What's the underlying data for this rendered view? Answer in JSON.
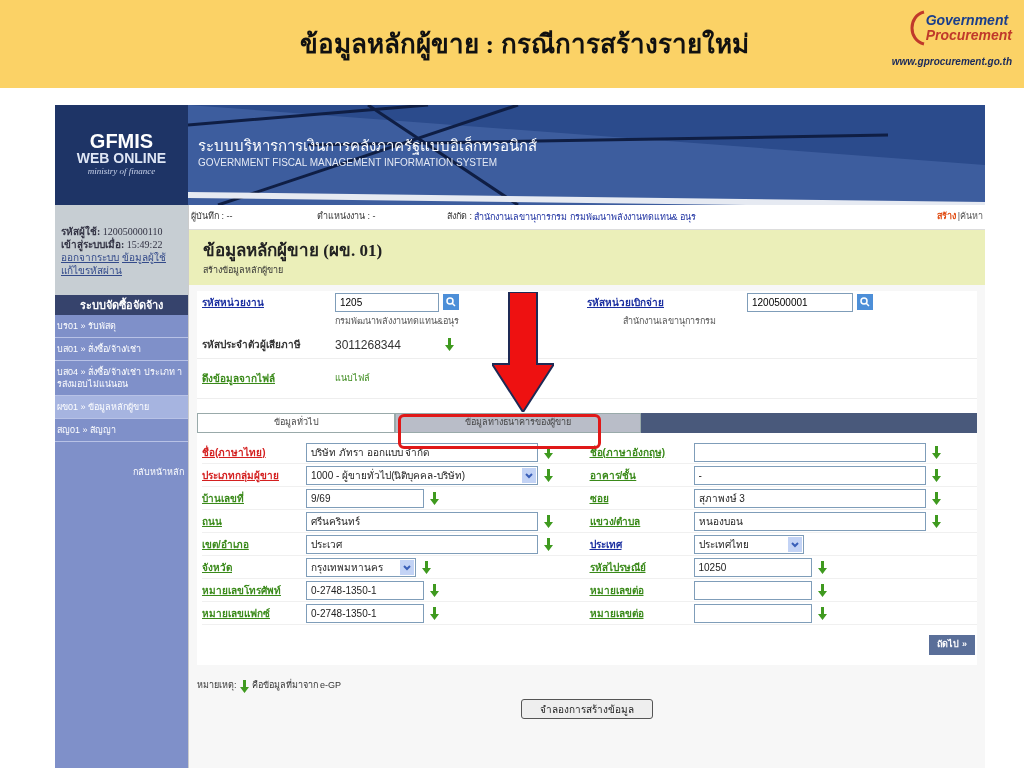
{
  "slide": {
    "title": "ข้อมูลหลักผู้ขาย : กรณีการสร้างรายใหม่",
    "logo_lines": [
      "Government",
      "Procurement"
    ],
    "url": "www.gprocurement.go.th"
  },
  "app": {
    "logo": {
      "title": "GFMIS",
      "subtitle": "WEB ONLINE",
      "tagline": "ministry of finance"
    },
    "system_name_th": "ระบบบริหารการเงินการคลังภาครัฐแบบอิเล็กทรอนิกส์",
    "system_name_en": "GOVERNMENT FISCAL MANAGEMENT INFORMATION SYSTEM",
    "user": {
      "id_label": "รหัสผู้ใช้:",
      "id": "120050000110",
      "login_label": "เข้าสู่ระบบเมื่อ:",
      "login_time": "15:49:22",
      "links": [
        "ออกจากระบบ",
        "ข้อมูลผู้ใช้",
        "แก้ไขรหัสผ่าน"
      ]
    },
    "menu": {
      "title": "ระบบจัดซื้อจัดจ้าง",
      "items": [
        {
          "label": "บร01 » รับพัสดุ",
          "selected": false
        },
        {
          "label": "บส01 » สั่งซื้อ/จ้าง/เช่า",
          "selected": false
        },
        {
          "label": "บส04 » สั่งซื้อ/จ้าง/เช่า ประเภท ารส่งมอบไม่แน่นอน",
          "selected": false
        },
        {
          "label": "ผข01 » ข้อมูลหลักผู้ขาย",
          "selected": true
        },
        {
          "label": "สญ01 » สัญญา",
          "selected": false
        }
      ],
      "back": "กลับหน้าหลัก"
    },
    "info_bar": {
      "recorder": "ผู้บันทึก : --",
      "position": "ตำแหน่งงาน : -",
      "affiliation_label": "สังกัด :",
      "affiliation": "สำนักงานเลขานุการกรม กรมพัฒนาพลังงานทดแทน& อนุร",
      "actions": [
        {
          "label": "สร้าง",
          "selected": true
        },
        {
          "label": "|ค้นหา",
          "selected": false
        }
      ]
    },
    "page_title": "ข้อมูลหลักผู้ขาย (ผข. 01)",
    "page_subtitle": "สร้างข้อมูลหลักผู้ขาย",
    "top_fields": {
      "agency_label": "รหัสหน่วยงาน",
      "agency_value": "1205",
      "agency_name": "กรมพัฒนาพลังงานทดแทน&อนุร",
      "disb_label": "รหัสหน่วยเบิกจ่าย",
      "disb_value": "1200500001",
      "disb_name": "สำนักงานเลขานุการกรม",
      "tax_label": "รหัสประจำตัวผู้เสียภาษี",
      "tax_value": "3011268344",
      "file_label": "ดึงข้อมูลจากไฟล์",
      "file_link": "แนบไฟล์"
    },
    "tabs": [
      {
        "label": "ข้อมูลทั่วไป",
        "selected": true
      },
      {
        "label": "ข้อมูลทางธนาคารของผู้ขาย",
        "selected": false
      }
    ],
    "form_rows": [
      [
        {
          "label": "ชื่อ(ภาษาไทย)",
          "color": "#d42020",
          "kind": "input",
          "value": "บริษัท ภัทรา ออกแบบ จำกัด",
          "from_egp": true
        },
        {
          "label": "ชื่อ(ภาษาอังกฤษ)",
          "color": "#3a8a1a",
          "kind": "input",
          "from_egp": true
        }
      ],
      [
        {
          "label": "ประเภทกลุ่มผู้ขาย",
          "color": "#d42020",
          "kind": "select",
          "value": "1000 - ผู้ขายทั่วไป(นิติบุคคล-บริษัท)",
          "from_egp": true
        },
        {
          "label": "อาคาร/ชั้น",
          "color": "#3a8a1a",
          "kind": "input",
          "value": "-",
          "from_egp": true
        }
      ],
      [
        {
          "label": "บ้านเลขที่",
          "color": "#3a8a1a",
          "kind": "input",
          "value": "9/69",
          "from_egp": true
        },
        {
          "label": "ซอย",
          "color": "#3a8a1a",
          "kind": "input",
          "value": "สุภาพงษ์ 3",
          "from_egp": true
        }
      ],
      [
        {
          "label": "ถนน",
          "color": "#3a8a1a",
          "kind": "input",
          "value": "ศรีนครินทร์",
          "from_egp": true
        },
        {
          "label": "แขวง/ตำบล",
          "color": "#3a8a1a",
          "kind": "input",
          "value": "หนองบอน",
          "from_egp": true
        }
      ],
      [
        {
          "label": "เขต/อำเภอ",
          "color": "#3a8a1a",
          "kind": "input",
          "value": "ประเวศ",
          "from_egp": true
        },
        {
          "label": "ประเทศ",
          "color": "#1a2ea0",
          "kind": "select",
          "value": "ประเทศไทย",
          "from_egp": false
        }
      ],
      [
        {
          "label": "จังหวัด",
          "color": "#3a8a1a",
          "kind": "select",
          "value": "กรุงเทพมหานคร",
          "from_egp": true
        },
        {
          "label": "รหัสไปรษณีย์",
          "color": "#3a8a1a",
          "kind": "input",
          "value": "10250",
          "from_egp": true
        }
      ],
      [
        {
          "label": "หมายเลขโทรศัพท์",
          "color": "#3a8a1a",
          "kind": "input",
          "value": "0-2748-1350-1",
          "from_egp": true
        },
        {
          "label": "หมายเลขต่อ",
          "color": "#3a8a1a",
          "kind": "input",
          "from_egp": true
        }
      ],
      [
        {
          "label": "หมายเลขแฟกซ์",
          "color": "#3a8a1a",
          "kind": "input",
          "value": "0-2748-1350-1",
          "from_egp": true
        },
        {
          "label": "หมายเลขต่อ",
          "color": "#3a8a1a",
          "kind": "input",
          "from_egp": true
        }
      ]
    ],
    "next_button": "ถัดไป »",
    "note_label": "หมายเหตุ:",
    "note_text": "คือข้อมูลที่มาจาก e-GP",
    "submit_button": "จำลองการสร้างข้อมูล"
  }
}
